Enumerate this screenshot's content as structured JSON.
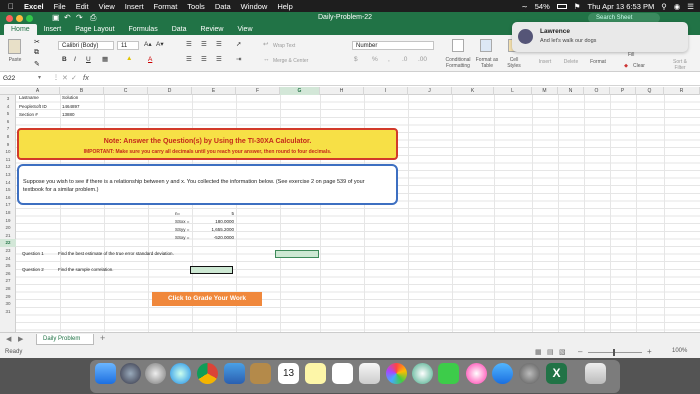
{
  "menubar": {
    "app": "Excel",
    "items": [
      "File",
      "Edit",
      "View",
      "Insert",
      "Format",
      "Tools",
      "Data",
      "Window",
      "Help"
    ],
    "battery": "54%",
    "clock": "Thu Apr 13  6:53 PM"
  },
  "window": {
    "title": "Daily-Problem-22",
    "search_placeholder": "Search Sheet"
  },
  "ribbon": {
    "tabs": [
      "Home",
      "Insert",
      "Page Layout",
      "Formulas",
      "Data",
      "Review",
      "View"
    ],
    "paste": "Paste",
    "font_name": "Calibri (Body)",
    "font_size": "11",
    "wrap_text": "Wrap Text",
    "merge_center": "Merge & Center",
    "number_format": "Number",
    "conditional_formatting": "Conditional Formatting",
    "format_as_table": "Format as Table",
    "cell_styles": "Cell Styles",
    "insert": "Insert",
    "delete": "Delete",
    "format": "Format",
    "fill": "Fill",
    "clear": "Clear",
    "sort_filter": "Sort & Filter"
  },
  "notification": {
    "sender": "Lawrence",
    "message": "And let's walk our dogs"
  },
  "formula_bar": {
    "cell_ref": "G22",
    "fx": "fx"
  },
  "columns": [
    "A",
    "B",
    "C",
    "D",
    "E",
    "F",
    "G",
    "H",
    "I",
    "J",
    "K",
    "L",
    "M",
    "N",
    "O",
    "P",
    "Q",
    "R"
  ],
  "rows": [
    "3",
    "4",
    "5",
    "6",
    "7",
    "8",
    "9",
    "10",
    "11",
    "12",
    "13",
    "14",
    "15",
    "16",
    "17",
    "18",
    "19",
    "20",
    "21",
    "22",
    "23",
    "24",
    "25",
    "26",
    "27",
    "28",
    "29",
    "30",
    "31"
  ],
  "sheet": {
    "a3": "Lastname",
    "b3": "Solution",
    "a4": "PeopleSoft ID",
    "b4": "1464897",
    "a5": "Section #",
    "b5": "13880",
    "note_title": "Note: Answer the Question(s) by Using the TI-30XA Calculator.",
    "note_subtitle": "IMPORTANT: Make sure you carry all decimals until you reach your answer, then round to four decimals.",
    "problem": "Suppose you wish to see if there is a relationship between y and x.  You collected the information below.  (See exercise 2 on page 539 of your textbook for a similar problem.)",
    "stats": [
      {
        "label": "n=",
        "value": "5"
      },
      {
        "label": "SSxx =",
        "value": "180.0000"
      },
      {
        "label": "SSyy =",
        "value": "1,655.2000"
      },
      {
        "label": "SSxy =",
        "value": "-520.0000"
      }
    ],
    "q1_label": "Question 1",
    "q1_text": "Find the best estimate of the true error standard deviation.",
    "q2_label": "Question 2",
    "q2_text": "Find the sample correlation.",
    "grade_button": "Click to Grade Your Work"
  },
  "sheet_tab": "Daily Problem",
  "status": {
    "ready": "Ready",
    "zoom": "100%"
  },
  "dock_calendar_day": "13"
}
